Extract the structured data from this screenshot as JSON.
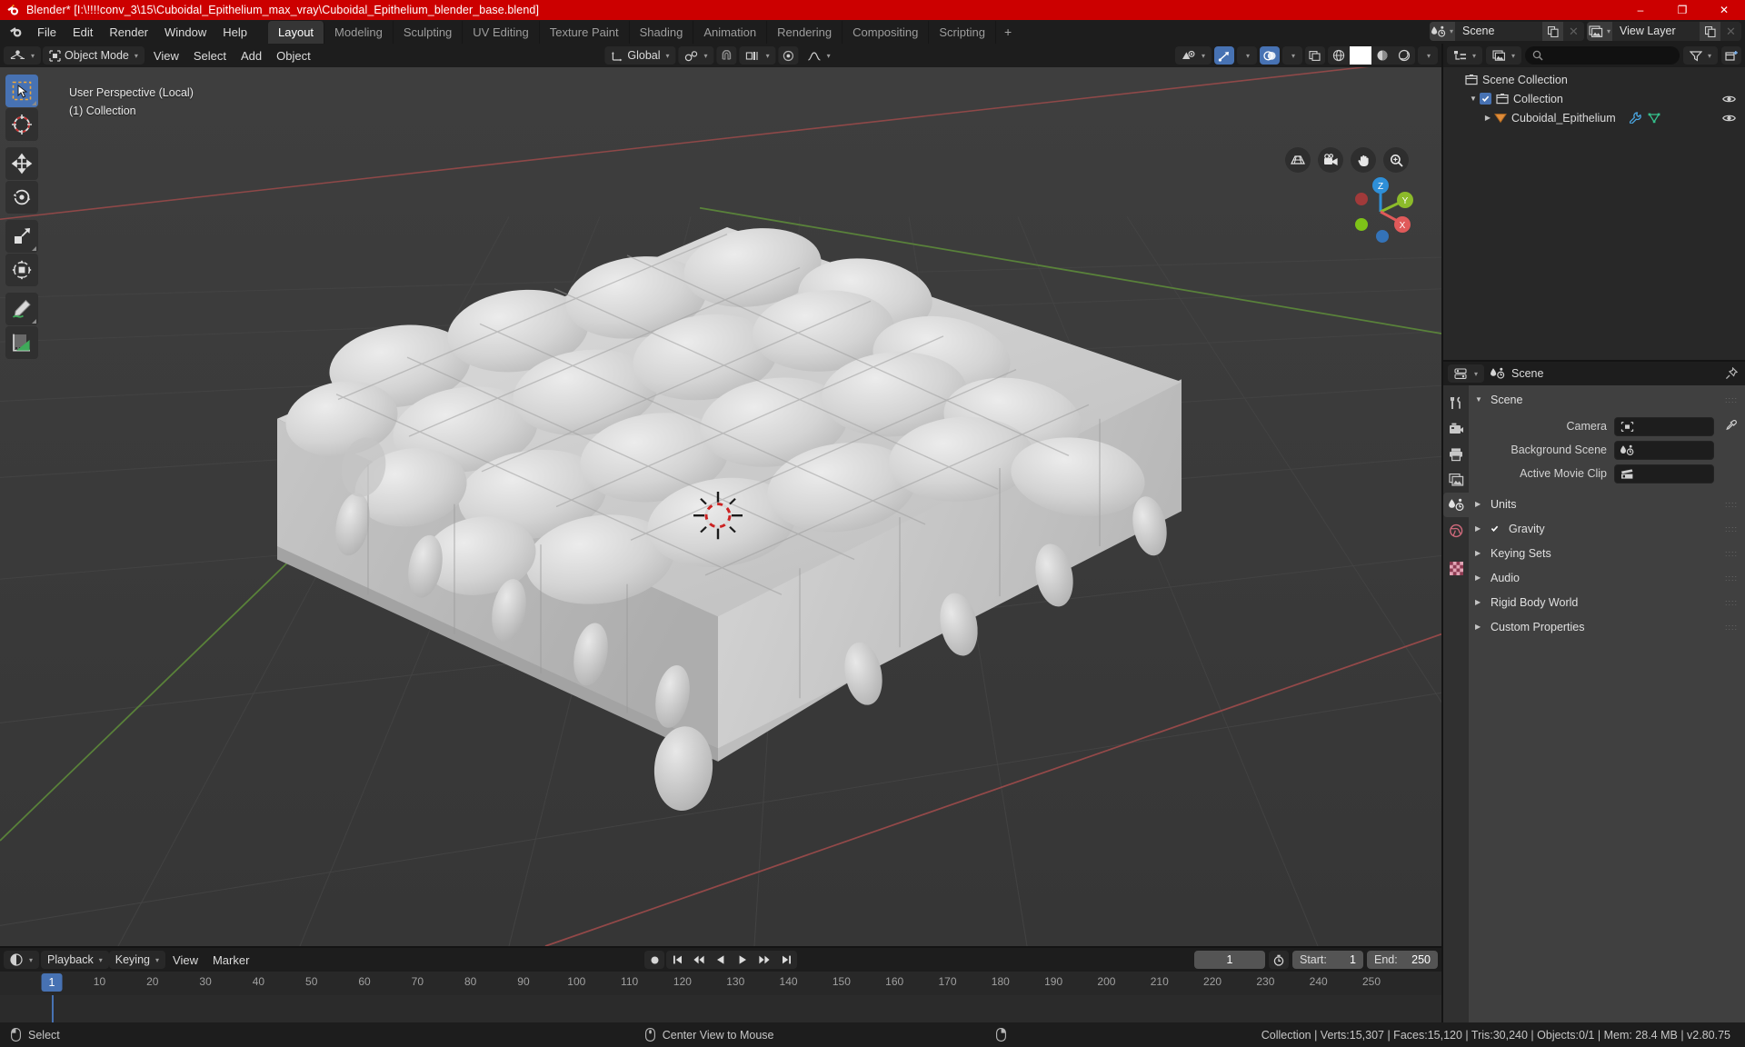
{
  "window": {
    "title": "Blender* [I:\\!!!!conv_3\\15\\Cuboidal_Epithelium_max_vray\\Cuboidal_Epithelium_blender_base.blend]",
    "minimize": "–",
    "maximize": "❐",
    "close": "✕",
    "accent_red": "#cc0000",
    "accent_blue": "#4772b3"
  },
  "topbar": {
    "menus": [
      "File",
      "Edit",
      "Render",
      "Window",
      "Help"
    ],
    "workspaces": [
      {
        "label": "Layout",
        "active": true
      },
      {
        "label": "Modeling",
        "active": false
      },
      {
        "label": "Sculpting",
        "active": false
      },
      {
        "label": "UV Editing",
        "active": false
      },
      {
        "label": "Texture Paint",
        "active": false
      },
      {
        "label": "Shading",
        "active": false
      },
      {
        "label": "Animation",
        "active": false
      },
      {
        "label": "Rendering",
        "active": false
      },
      {
        "label": "Compositing",
        "active": false
      },
      {
        "label": "Scripting",
        "active": false
      }
    ],
    "add_workspace": "+",
    "scene_name": "Scene",
    "view_layer_name": "View Layer"
  },
  "viewport_header": {
    "mode": "Object Mode",
    "menus": [
      "View",
      "Select",
      "Add",
      "Object"
    ],
    "transform_orientation": "Global"
  },
  "viewport": {
    "overlay_line1": "User Perspective (Local)",
    "overlay_line2": "(1) Collection",
    "gizmo_axes": [
      {
        "label": "Z",
        "color": "#2e8fd8"
      },
      {
        "label": "Y",
        "color": "#8cbb2a"
      },
      {
        "label": "X",
        "color": "#e05a5a"
      }
    ],
    "nav_buttons": [
      "grid-icon",
      "camera-icon",
      "hand-icon",
      "zoom-icon"
    ],
    "tools": [
      {
        "name": "select-box-tool",
        "active": true
      },
      {
        "name": "cursor-tool",
        "active": false
      },
      {
        "name": "move-tool",
        "active": false
      },
      {
        "name": "rotate-tool",
        "active": false
      },
      {
        "name": "scale-tool",
        "active": false
      },
      {
        "name": "transform-tool",
        "active": false
      },
      {
        "name": "annotate-tool",
        "active": false
      },
      {
        "name": "measure-tool",
        "active": false
      }
    ]
  },
  "outliner": {
    "search_placeholder": "",
    "rows": [
      {
        "label": "Scene Collection",
        "indent": 0,
        "icon": "collection-icon",
        "expand": "",
        "checkbox": false,
        "eye": false,
        "mods": []
      },
      {
        "label": "Collection",
        "indent": 1,
        "icon": "collection-icon",
        "expand": "▼",
        "checkbox": true,
        "eye": true,
        "mods": []
      },
      {
        "label": "Cuboidal_Epithelium",
        "indent": 2,
        "icon": "mesh-object-icon",
        "expand": "▶",
        "checkbox": false,
        "eye": true,
        "mods": [
          "wrench-icon",
          "mesh-data-icon"
        ]
      }
    ]
  },
  "properties": {
    "breadcrumb": "Scene",
    "tabs": [
      {
        "name": "tool-tab",
        "active": false
      },
      {
        "name": "render-tab",
        "active": false
      },
      {
        "name": "output-tab",
        "active": false
      },
      {
        "name": "view-layer-tab",
        "active": false
      },
      {
        "name": "scene-tab",
        "active": true
      },
      {
        "name": "world-tab",
        "active": false
      },
      {
        "name": "texture-tab",
        "active": false
      }
    ],
    "scene_panel": "Scene",
    "fields": [
      {
        "label": "Camera",
        "value": "",
        "icon": "camera-data-icon",
        "eyedropper": true
      },
      {
        "label": "Background Scene",
        "value": "",
        "icon": "scene-icon",
        "eyedropper": false
      },
      {
        "label": "Active Movie Clip",
        "value": "",
        "icon": "clip-icon",
        "eyedropper": false
      }
    ],
    "panels": [
      {
        "label": "Units",
        "checkbox": null
      },
      {
        "label": "Gravity",
        "checkbox": true
      },
      {
        "label": "Keying Sets",
        "checkbox": null
      },
      {
        "label": "Audio",
        "checkbox": null
      },
      {
        "label": "Rigid Body World",
        "checkbox": null
      },
      {
        "label": "Custom Properties",
        "checkbox": null
      }
    ]
  },
  "timeline": {
    "menus": [
      "Playback",
      "Keying",
      "View",
      "Marker"
    ],
    "current_frame": "1",
    "start_label": "Start:",
    "start_value": "1",
    "end_label": "End:",
    "end_value": "250",
    "ticks": [
      "1",
      "10",
      "20",
      "30",
      "40",
      "50",
      "60",
      "70",
      "80",
      "90",
      "100",
      "110",
      "120",
      "130",
      "140",
      "150",
      "160",
      "170",
      "180",
      "190",
      "200",
      "210",
      "220",
      "230",
      "240",
      "250"
    ]
  },
  "statusbar": {
    "mouse_left_action": "Select",
    "mouse_middle_action": "Center View to Mouse",
    "stats": "Collection | Verts:15,307 | Faces:15,120 | Tris:30,240 | Objects:0/1 | Mem: 28.4 MB | v2.80.75"
  }
}
